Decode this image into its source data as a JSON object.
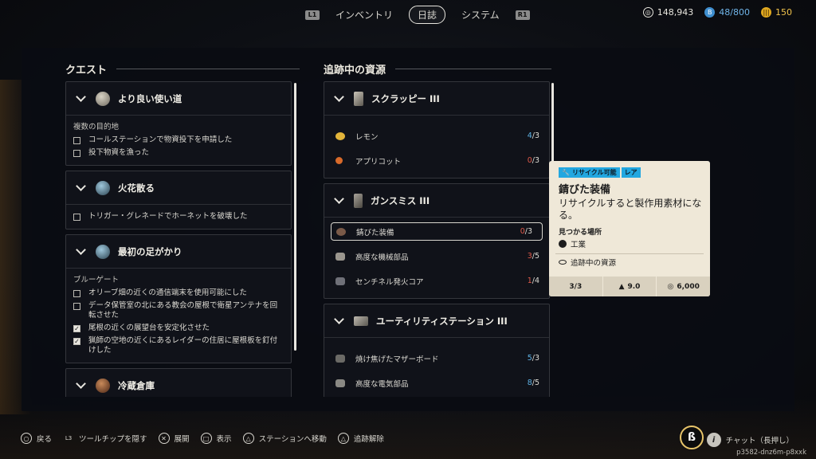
{
  "tabs": {
    "left_key": "L1",
    "right_key": "R1",
    "items": [
      "インベントリ",
      "日誌",
      "システム"
    ],
    "active_index": 1
  },
  "currencies": {
    "coins": "148,943",
    "storage": "48/800",
    "tokens": "150"
  },
  "quests": {
    "title": "クエスト",
    "cards": [
      {
        "title": "より良い使い道",
        "subhead": "複数の目的地",
        "objectives": [
          {
            "text": "コールステーションで物資投下を申請した",
            "done": false
          },
          {
            "text": "投下物資を漁った",
            "done": false
          }
        ]
      },
      {
        "title": "火花散る",
        "subhead": "",
        "objectives": [
          {
            "text": "トリガー・グレネードでホーネットを破壊した",
            "done": false
          }
        ]
      },
      {
        "title": "最初の足がかり",
        "subhead": "ブルーゲート",
        "objectives": [
          {
            "text": "オリーブ畑の近くの通信端末を使用可能にした",
            "done": false
          },
          {
            "text": "データ保管室の北にある教会の屋根で衛星アンテナを回転させた",
            "done": false
          },
          {
            "text": "尾根の近くの展望台を安定化させた",
            "done": true
          },
          {
            "text": "猟師の空地の近くにあるレイダーの住居に屋根板を釘付けした",
            "done": true
          }
        ]
      },
      {
        "title": "冷蔵倉庫",
        "subhead": "",
        "objectives": []
      }
    ]
  },
  "resources": {
    "title": "追跡中の資源",
    "cards": [
      {
        "title": "スクラッピー III",
        "items": [
          {
            "name": "レモン",
            "have": "4",
            "need": "/3",
            "status": "blue"
          },
          {
            "name": "アプリコット",
            "have": "0",
            "need": "/3",
            "status": "red"
          }
        ]
      },
      {
        "title": "ガンスミス III",
        "items": [
          {
            "name": "錆びた装備",
            "have": "0",
            "need": "/3",
            "status": "red",
            "selected": true
          },
          {
            "name": "高度な機械部品",
            "have": "3",
            "need": "/5",
            "status": "red"
          },
          {
            "name": "センチネル発火コア",
            "have": "1",
            "need": "/4",
            "status": "red"
          }
        ]
      },
      {
        "title": "ユーティリティステーション III",
        "items": [
          {
            "name": "焼け焦げたマザーボード",
            "have": "5",
            "need": "/3",
            "status": "blue"
          },
          {
            "name": "高度な電気部品",
            "have": "8",
            "need": "/5",
            "status": "blue"
          }
        ]
      }
    ]
  },
  "tooltip": {
    "badge_recyclable": "リサイクル可能",
    "badge_rarity": "レア",
    "title": "錆びた装備",
    "description": "リサイクルすると製作用素材になる。",
    "found_label": "見つかる場所",
    "location": "工業",
    "tracked": "追跡中の資源",
    "stats": [
      "3/3",
      "9.0",
      "6,000"
    ]
  },
  "hints": [
    {
      "glyph": "○",
      "label": "戻る"
    },
    {
      "glyph": "L3",
      "label": "ツールチップを隠す"
    },
    {
      "glyph": "✕",
      "label": "展開"
    },
    {
      "glyph": "□",
      "label": "表示"
    },
    {
      "glyph": "△",
      "label": "ステーションへ移動"
    },
    {
      "glyph": "△",
      "label": "追跡解除"
    }
  ],
  "chat": "チャット（長押し）",
  "session_id": "p3582-dnz6m-p8xxk",
  "colors": {
    "accent_blue": "#22a7e0",
    "count_blue": "#5fb3e6",
    "count_red": "#e05a4a"
  }
}
